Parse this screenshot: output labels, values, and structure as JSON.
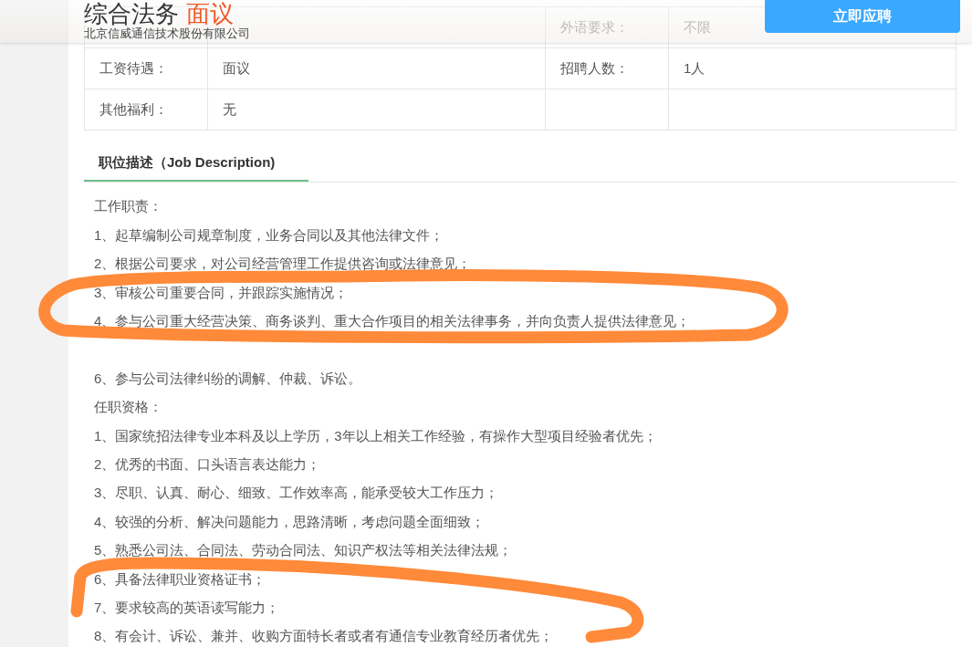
{
  "header": {
    "title": "综合法务",
    "salary": "面议",
    "company": "北京信威通信技术股份有限公司",
    "apply_button": "立即应聘"
  },
  "info_rows": [
    {
      "label_2": "外语要求：",
      "value_2": "不限",
      "faded": true
    },
    {
      "label": "工资待遇：",
      "value": "面议",
      "label_2": "招聘人数：",
      "value_2": "1人",
      "faded": false
    },
    {
      "label": "其他福利：",
      "value": "无",
      "faded": false
    }
  ],
  "tab": {
    "label": "职位描述（Job Description)",
    "selected": true
  },
  "sections": [
    {
      "heading": "工作职责：",
      "items": [
        {
          "kind": "line",
          "text": "1、起草编制公司规章制度，业务合同以及其他法律文件；"
        },
        {
          "kind": "line",
          "text": "2、根据公司要求，对公司经营管理工作提供咨询或法律意见；"
        },
        {
          "kind": "line",
          "text": "3、审核公司重要合同，并跟踪实施情况；"
        },
        {
          "kind": "line",
          "text": "4、参与公司重大经营决策、商务谈判、重大合作项目的相关法律事务，并向负责人提供法律意见；"
        },
        {
          "kind": "hidden"
        },
        {
          "kind": "line",
          "text": "6、参与公司法律纠纷的调解、仲裁、诉讼。"
        }
      ]
    },
    {
      "heading": "任职资格：",
      "items": [
        {
          "kind": "line",
          "text": "1、国家统招法律专业本科及以上学历，3年以上相关工作经验，有操作大型项目经验者优先；"
        },
        {
          "kind": "line",
          "text": "2、优秀的书面、口头语言表达能力；"
        },
        {
          "kind": "line",
          "text": "3、尽职、认真、耐心、细致、工作效率高，能承受较大工作压力；"
        },
        {
          "kind": "line",
          "text": "4、较强的分析、解决问题能力，思路清晰，考虑问题全面细致；"
        },
        {
          "kind": "line",
          "text": "5、熟悉公司法、合同法、劳动合同法、知识产权法等相关法律法规；"
        },
        {
          "kind": "line",
          "text": "6、具备法律职业资格证书；"
        },
        {
          "kind": "line",
          "text": "7、要求较高的英语读写能力；"
        },
        {
          "kind": "line",
          "text": "8、有会计、诉讼、兼并、收购方面特长者或者有通信专业教育经历者优先；"
        }
      ]
    }
  ]
}
